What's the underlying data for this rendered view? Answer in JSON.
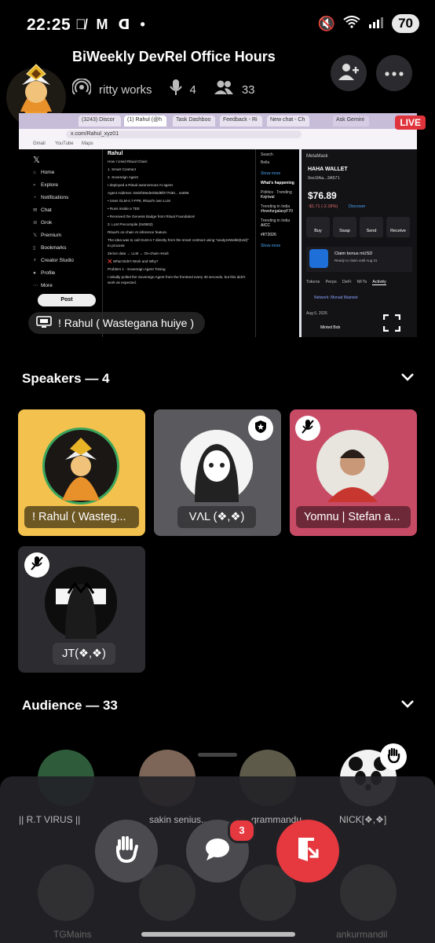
{
  "status_bar": {
    "time": "22:25",
    "battery": "70",
    "signal_label": "5"
  },
  "header": {
    "title": "BiWeekly DevRel Office Hours",
    "host": "ritty works",
    "speaker_count": "4",
    "listener_count": "33"
  },
  "stream": {
    "live_label": "LIVE",
    "sharer_name": "! Rahul ( Wastegana huiye )",
    "browser": {
      "tabs": [
        "(3243) Discor",
        "(1) Rahul (@h",
        "Task Dashboo",
        "Feedback - Ri",
        "New chat - Ch"
      ],
      "ask_gemini": "Ask Gemini",
      "url": "x.com/Rahul_xyz01",
      "bookmarks": [
        "Gmail",
        "YouTube",
        "Maps"
      ]
    },
    "x_nav": [
      "Home",
      "Explore",
      "Notifications",
      "Chat",
      "Grok",
      "Premium",
      "Bookmarks",
      "Creator Studio",
      "Profile",
      "More"
    ],
    "x_post_button": "Post",
    "x_post": {
      "author": "Rahul",
      "lines": [
        "How I Used Ritual Chain:",
        "1. Smart Contract",
        "2. Sovereign Agent",
        "I deployed a Ritual autonomous AI agent.",
        "Agent Address: 0x82f48ede035d9f077030... sa056",
        "• Uses GLM-4.7-FP8, Ritual's own LLM",
        "• Runs inside a TEE",
        "• Received the Genesis Badge from Ritual Foundation!",
        "3. LLM Precompile (0x0802)",
        "Ritual's on-chain AI inference feature.",
        "The idea was to call GLM-4.7 directly from the smart contract using \"analyzeWallet(txId)\" to process:",
        "Zerion data → LLM → On-chain result",
        "❌ What Didn't Work and Why?",
        "Problem 1 - Sovereign Agent Timing",
        "I initially polled the Sovereign Agent from the frontend every 30 seconds, but this didn't work as expected."
      ]
    },
    "x_side": [
      "Search",
      "Bella",
      "Show more",
      "What's happening",
      "Politics · Trending",
      "Kejriwal",
      "Trending in India",
      "#lovefurgalaxyF70",
      "Trending in India",
      "AICC",
      "#IIT2026",
      "Show more"
    ],
    "metamask": {
      "app": "MetaMask",
      "wallet": "HAHA WALLET",
      "address": "0xe1fAa...3A571",
      "balance": "$76.89",
      "change": "-$1.71 (-2.18%)",
      "discover": "Discover",
      "actions": [
        "Buy",
        "Swap",
        "Send",
        "Receive"
      ],
      "promo_title": "Claim bonus mUSD",
      "promo_sub": "Ready to claim until Aug 31",
      "tabs": [
        "Tokens",
        "Perps",
        "DeFi",
        "NFTs",
        "Activity"
      ],
      "network": "Network: Monad Mainnet",
      "date": "Aug 6, 2026",
      "tx": "Minted Bob"
    }
  },
  "speakers": {
    "header": "Speakers — 4",
    "items": [
      {
        "name": "! Rahul ( Wasteg...",
        "bg": "#f2c14e"
      },
      {
        "name": "VΛL (❖,❖)",
        "bg": "#5a5a5e"
      },
      {
        "name": "Yomnu | Stefan a...",
        "bg": "#c84b66"
      },
      {
        "name": "JT(❖,❖)",
        "bg": "#2b2b30"
      }
    ]
  },
  "audience": {
    "header": "Audience — 33",
    "names": [
      "|| R.T VIRUS ||",
      "sakin senius...",
      "grammandu...",
      "NICK[❖,❖]"
    ],
    "names_row2": [
      "TGMains",
      "",
      "",
      "ankurmandil"
    ]
  },
  "controls": {
    "chat_badge": "3"
  },
  "colors": {
    "live": "#e0343c",
    "leave": "#e5383f",
    "speaking_ring": "#3ba55c"
  }
}
